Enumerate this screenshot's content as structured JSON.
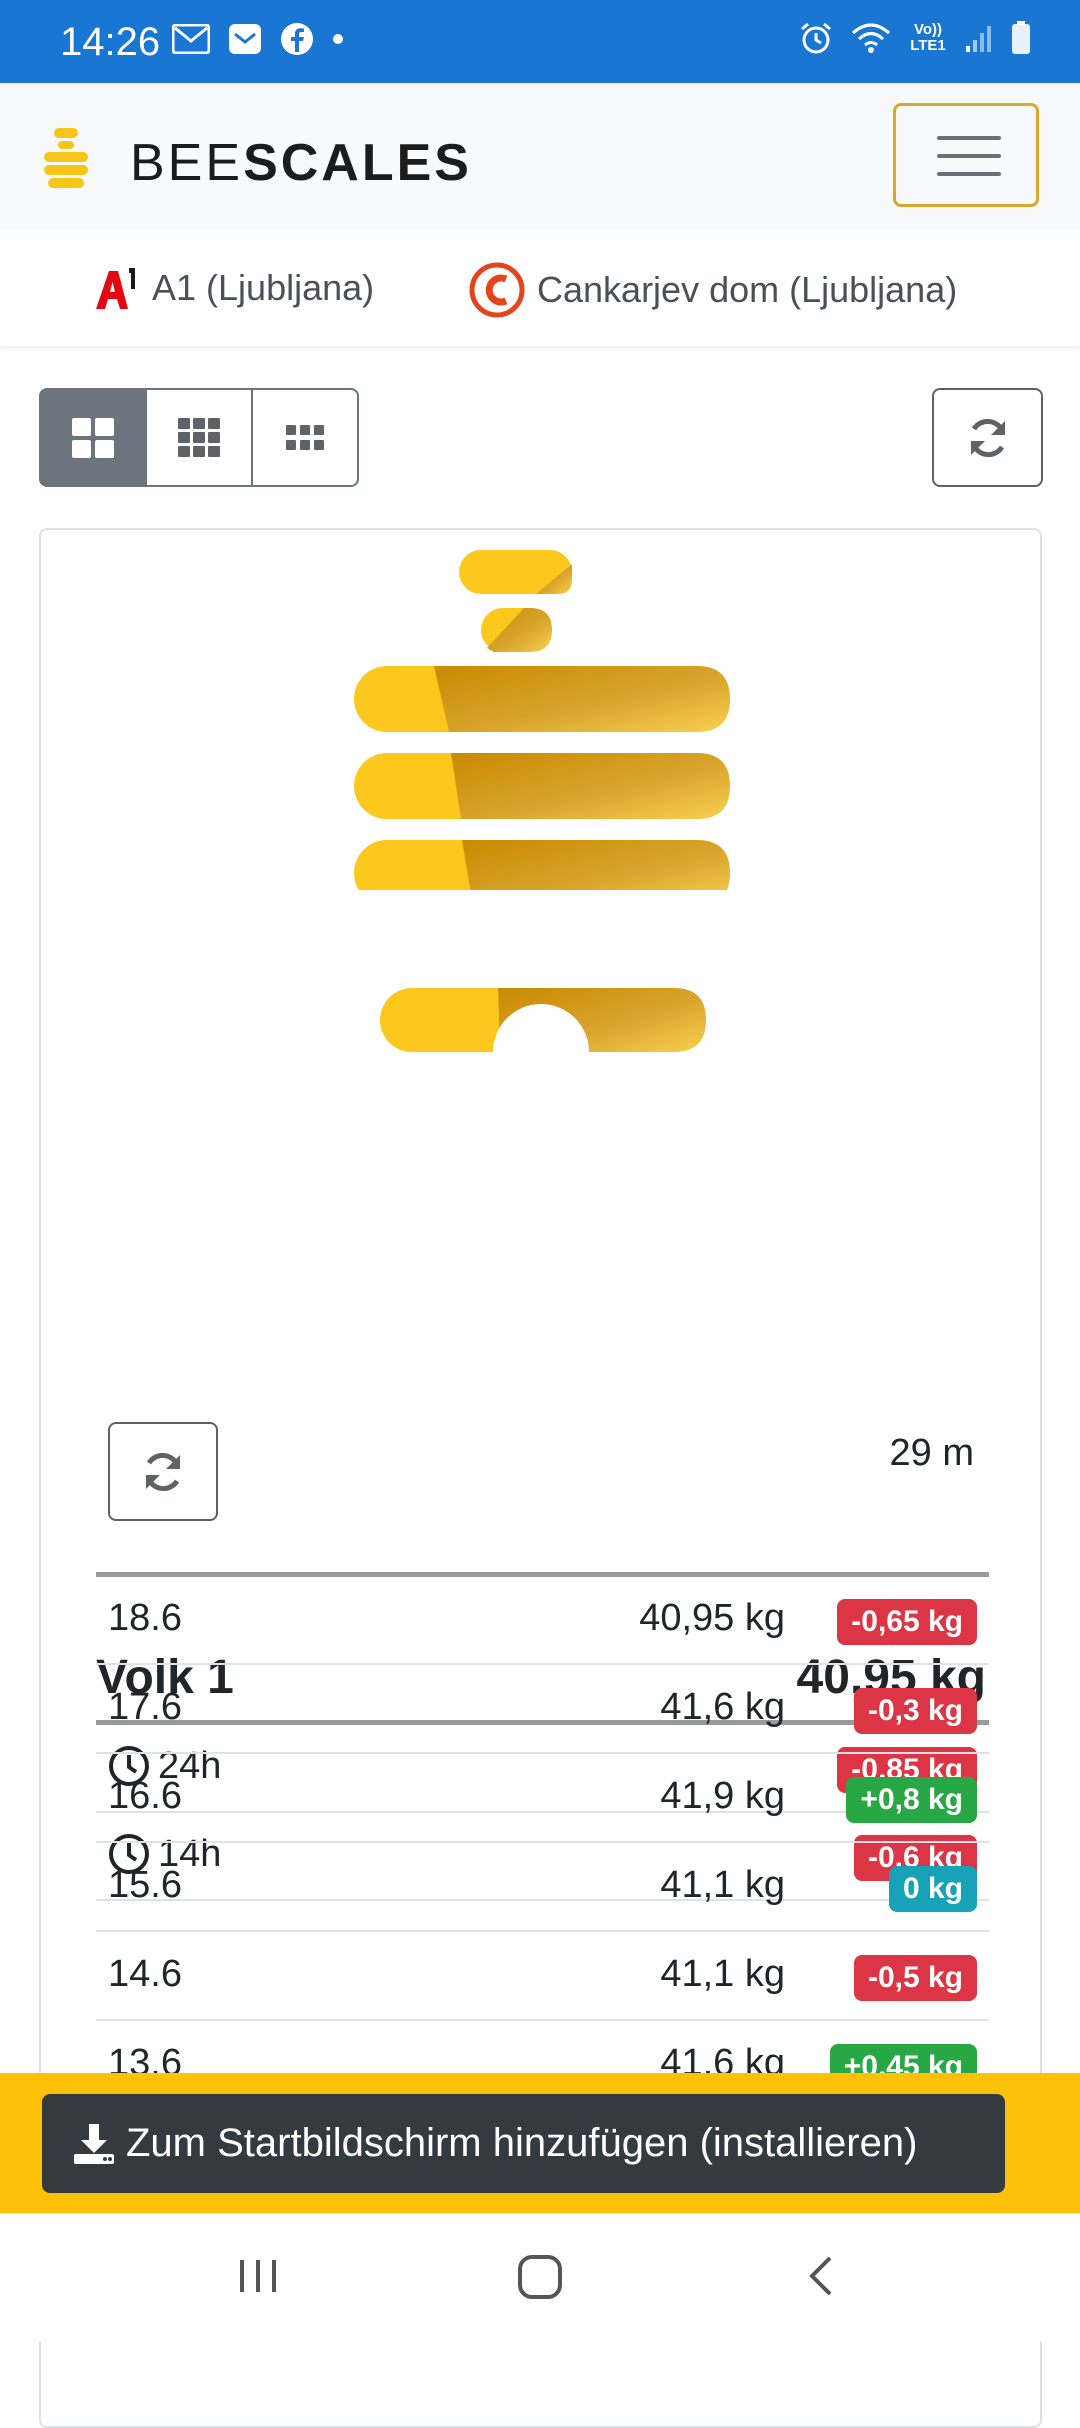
{
  "status_bar": {
    "time": "14:26",
    "left_icons": [
      "gmail-icon",
      "message-icon",
      "facebook-icon",
      "dot-icon"
    ],
    "right_icons": [
      "alarm-icon",
      "wifi-icon",
      "volte-icon",
      "signal-icon",
      "battery-icon"
    ],
    "volte_label": "Vo)) LTE1",
    "bg_color": "#1976d2"
  },
  "navbar": {
    "brand_light": "BEE",
    "brand_bold": "SCALES",
    "menu_icon": "hamburger-menu-icon"
  },
  "partners": [
    {
      "icon": "a1-logo",
      "label": "A1 (Ljubljana)"
    },
    {
      "icon": "cankarjev-dom-logo",
      "label": "Cankarjev dom (Ljubljana)"
    }
  ],
  "view_toggle": {
    "options": [
      "large-grid-icon",
      "medium-grid-icon",
      "small-grid-icon"
    ],
    "active_index": 0
  },
  "card": {
    "title": "Volk 1",
    "weight": "40,95 kg",
    "summary": [
      {
        "label": "24h",
        "delta": "-0,85 kg",
        "tone": "red"
      },
      {
        "label": "14h",
        "delta": "-0,6 kg",
        "tone": "red"
      }
    ],
    "last_update": "29 m",
    "history": [
      {
        "date": "18.6",
        "weight": "40,95 kg",
        "delta": "-0,65 kg",
        "tone": "red"
      },
      {
        "date": "17.6",
        "weight": "41,6 kg",
        "delta": "-0,3 kg",
        "tone": "red"
      },
      {
        "date": "16.6",
        "weight": "41,9 kg",
        "delta": "+0,8 kg",
        "tone": "green"
      },
      {
        "date": "15.6",
        "weight": "41,1 kg",
        "delta": "0 kg",
        "tone": "cyan"
      },
      {
        "date": "14.6",
        "weight": "41,1 kg",
        "delta": "-0,5 kg",
        "tone": "red"
      },
      {
        "date": "13.6",
        "weight": "41,6 kg",
        "delta": "+0,45 kg",
        "tone": "green"
      }
    ]
  },
  "install_banner": {
    "label": "Zum Startbildschirm hinzufügen (installieren)"
  },
  "colors": {
    "accent": "#ffc107",
    "danger": "#dc3545",
    "success": "#28a745",
    "info": "#17a2b8",
    "dark": "#343a40"
  }
}
